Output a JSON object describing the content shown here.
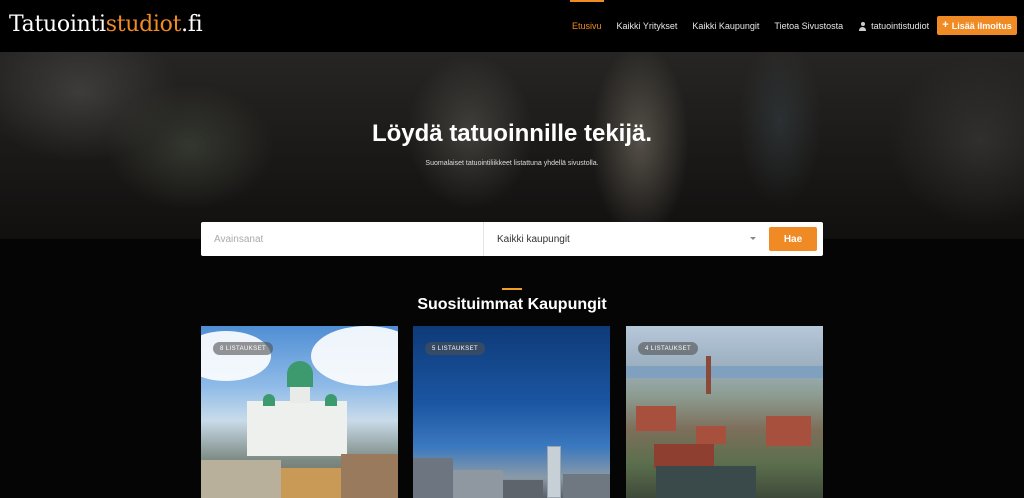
{
  "brand": {
    "name_part1": "Tatuointi",
    "name_part2": "studiot",
    "name_part3": ".fi"
  },
  "nav": {
    "items": [
      {
        "label": "Etusivu",
        "active": true
      },
      {
        "label": "Kaikki Yritykset"
      },
      {
        "label": "Kaikki Kaupungit"
      },
      {
        "label": "Tietoa Sivustosta"
      }
    ],
    "user_label": "tatuointistudiot",
    "add_button_label": "Lisää ilmoitus"
  },
  "hero": {
    "title": "Löydä tatuoinnille tekijä.",
    "subtitle": "Suomalaiset tatuointiliikkeet listattuna yhdellä sivustolla."
  },
  "search": {
    "keywords_placeholder": "Avainsanat",
    "city_selected": "Kaikki kaupungit",
    "button_label": "Hae"
  },
  "section": {
    "title": "Suosituimmat Kaupungit"
  },
  "cards": [
    {
      "badge": "8 LISTAUKSET"
    },
    {
      "badge": "5 LISTAUKSET"
    },
    {
      "badge": "4 LISTAUKSET"
    }
  ],
  "colors": {
    "accent": "#f08a24",
    "divider": "#f0a020",
    "background": "#050505"
  }
}
